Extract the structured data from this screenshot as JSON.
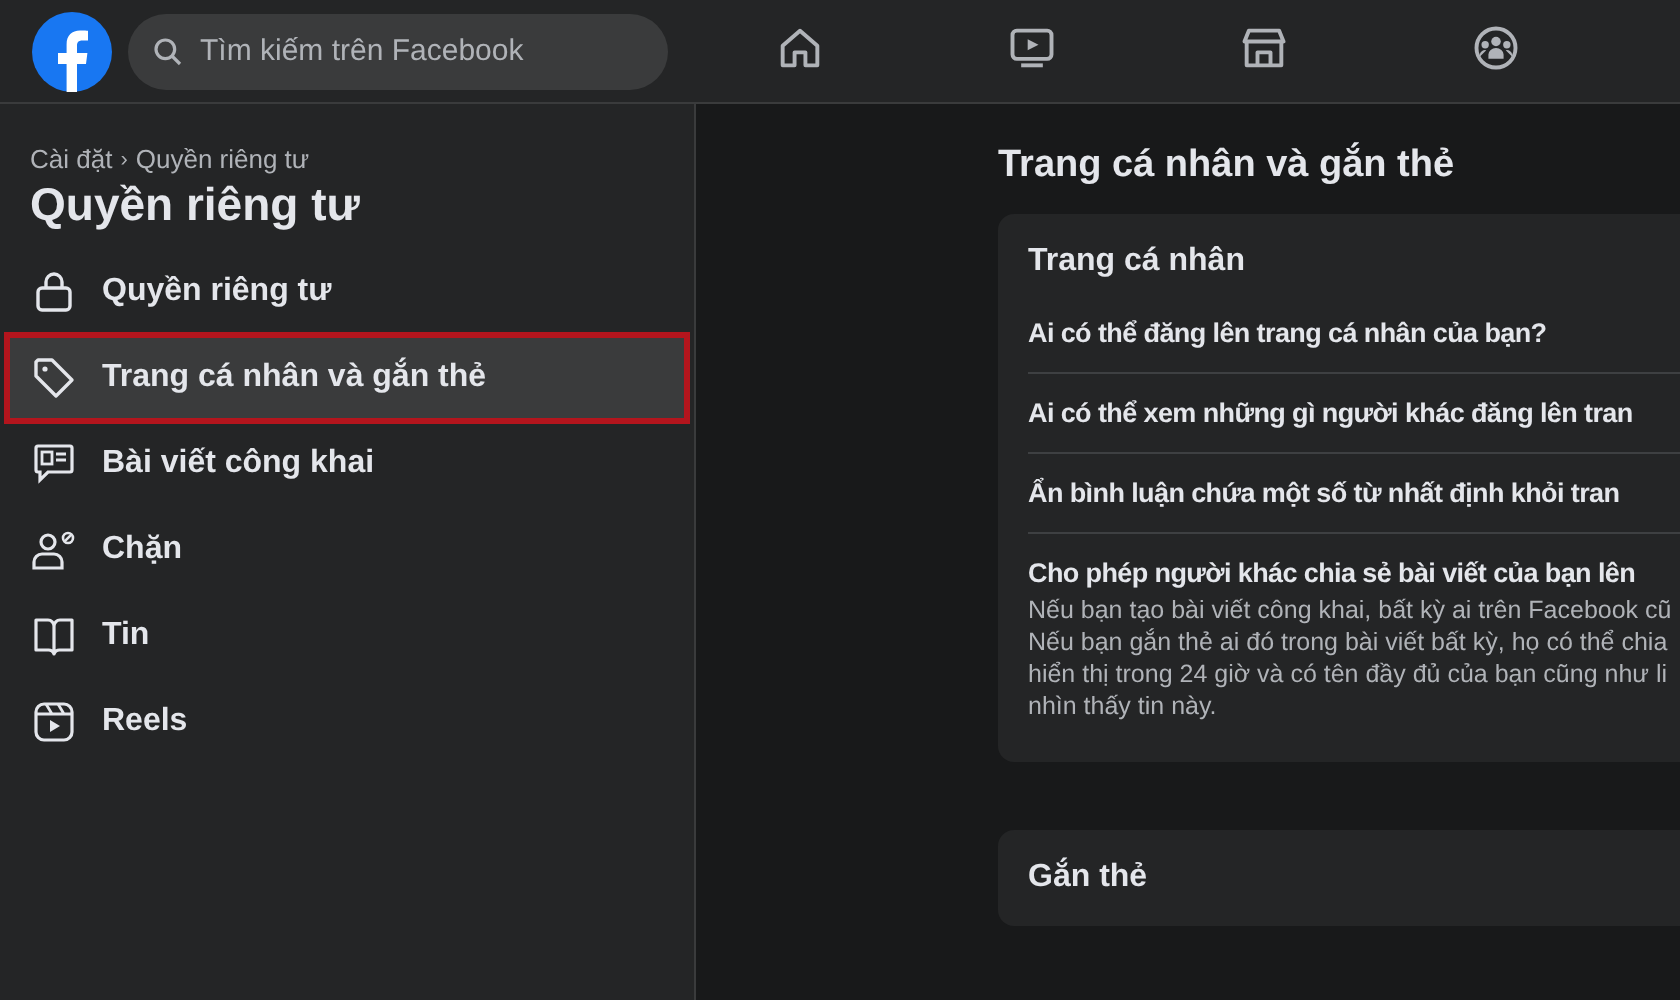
{
  "top_bar": {
    "search": {
      "placeholder": "Tìm kiếm trên Facebook"
    },
    "nav": [
      {
        "kind": "home",
        "selected": false
      },
      {
        "kind": "video",
        "selected": false
      },
      {
        "kind": "store",
        "selected": false
      },
      {
        "kind": "groups",
        "selected": false
      }
    ]
  },
  "sidebar": {
    "breadcrumb": [
      "Cài đặt",
      "Quyền riêng tư"
    ],
    "breadcrumb_separator": "›",
    "title": "Quyền riêng tư",
    "items": [
      {
        "kind": "lock",
        "label": "Quyền riêng tư",
        "selected": false
      },
      {
        "kind": "tag",
        "label": "Trang cá nhân và gắn thẻ",
        "selected": true
      },
      {
        "kind": "post",
        "label": "Bài viết công khai",
        "selected": false
      },
      {
        "kind": "block",
        "label": "Chặn",
        "selected": false
      },
      {
        "kind": "book",
        "label": "Tin",
        "selected": false
      },
      {
        "kind": "reels",
        "label": "Reels",
        "selected": false
      }
    ]
  },
  "main": {
    "title": "Trang cá nhân và gắn thẻ",
    "sections": [
      {
        "title": "Trang cá nhân",
        "settings": [
          {
            "label": "Ai có thể đăng lên trang cá nhân của bạn?"
          },
          {
            "label": "Ai có thể xem những gì người khác đăng lên tran"
          },
          {
            "label": "Ẩn bình luận chứa một số từ nhất định khỏi tran"
          },
          {
            "label": "Cho phép người khác chia sẻ bài viết của bạn lên",
            "description_lines": [
              "Nếu bạn tạo bài viết công khai, bất kỳ ai trên Facebook cũ",
              "Nếu bạn gắn thẻ ai đó trong bài viết bất kỳ, họ có thể chia",
              "hiển thị trong 24 giờ và có tên đầy đủ của bạn cũng như li",
              "nhìn thấy tin này."
            ]
          }
        ]
      },
      {
        "title": "Gắn thẻ"
      }
    ]
  }
}
